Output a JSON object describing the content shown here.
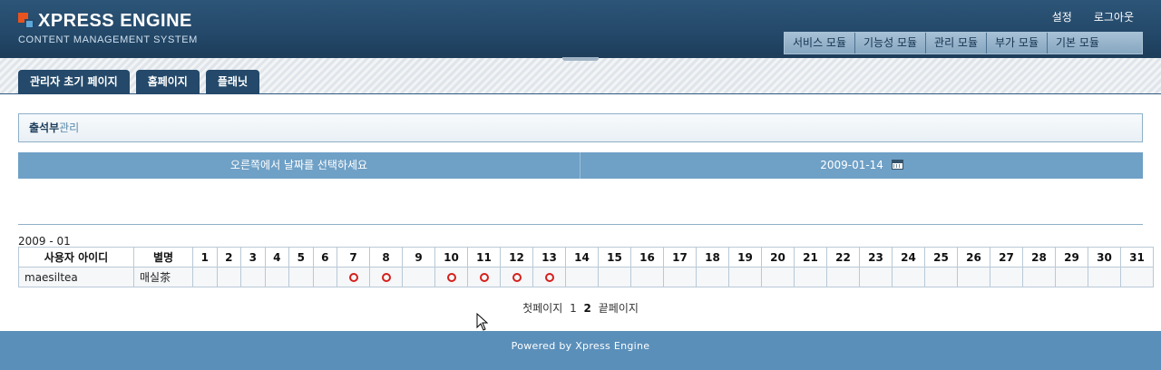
{
  "header": {
    "logo_title": "XPRESS ENGINE",
    "logo_subtitle": "CONTENT MANAGEMENT SYSTEM",
    "util": {
      "settings": "설정",
      "logout": "로그아웃"
    },
    "gnb": [
      "서비스 모듈",
      "기능성 모듈",
      "관리 모듈",
      "부가 모듈",
      "기본 모듈"
    ]
  },
  "tabs": [
    "관리자 초기 페이지",
    "홈페이지",
    "플래닛"
  ],
  "title": {
    "strong": "출석부",
    "rest": "관리"
  },
  "date_bar": {
    "instruction": "오른쪽에서 날짜를 선택하세요",
    "selected_date": "2009-01-14"
  },
  "month_label": "2009 - 01",
  "table": {
    "headers": {
      "user_id": "사용자 아이디",
      "nickname": "별명"
    },
    "days": [
      "1",
      "2",
      "3",
      "4",
      "5",
      "6",
      "7",
      "8",
      "9",
      "10",
      "11",
      "12",
      "13",
      "14",
      "15",
      "16",
      "17",
      "18",
      "19",
      "20",
      "21",
      "22",
      "23",
      "24",
      "25",
      "26",
      "27",
      "28",
      "29",
      "30",
      "31"
    ],
    "rows": [
      {
        "user_id": "maesiltea",
        "nickname": "매실茶",
        "attended_days": [
          7,
          8,
          10,
          11,
          12,
          13
        ]
      }
    ]
  },
  "pager": {
    "first": "첫페이지",
    "pages": [
      "1",
      "2"
    ],
    "current": "2",
    "last": "끝페이지"
  },
  "footer": {
    "text": "Powered by Xpress Engine"
  },
  "colors": {
    "header": "#24496a",
    "bar": "#6fa0c6",
    "footer": "#5a8fba",
    "mark": "#d4201b"
  }
}
